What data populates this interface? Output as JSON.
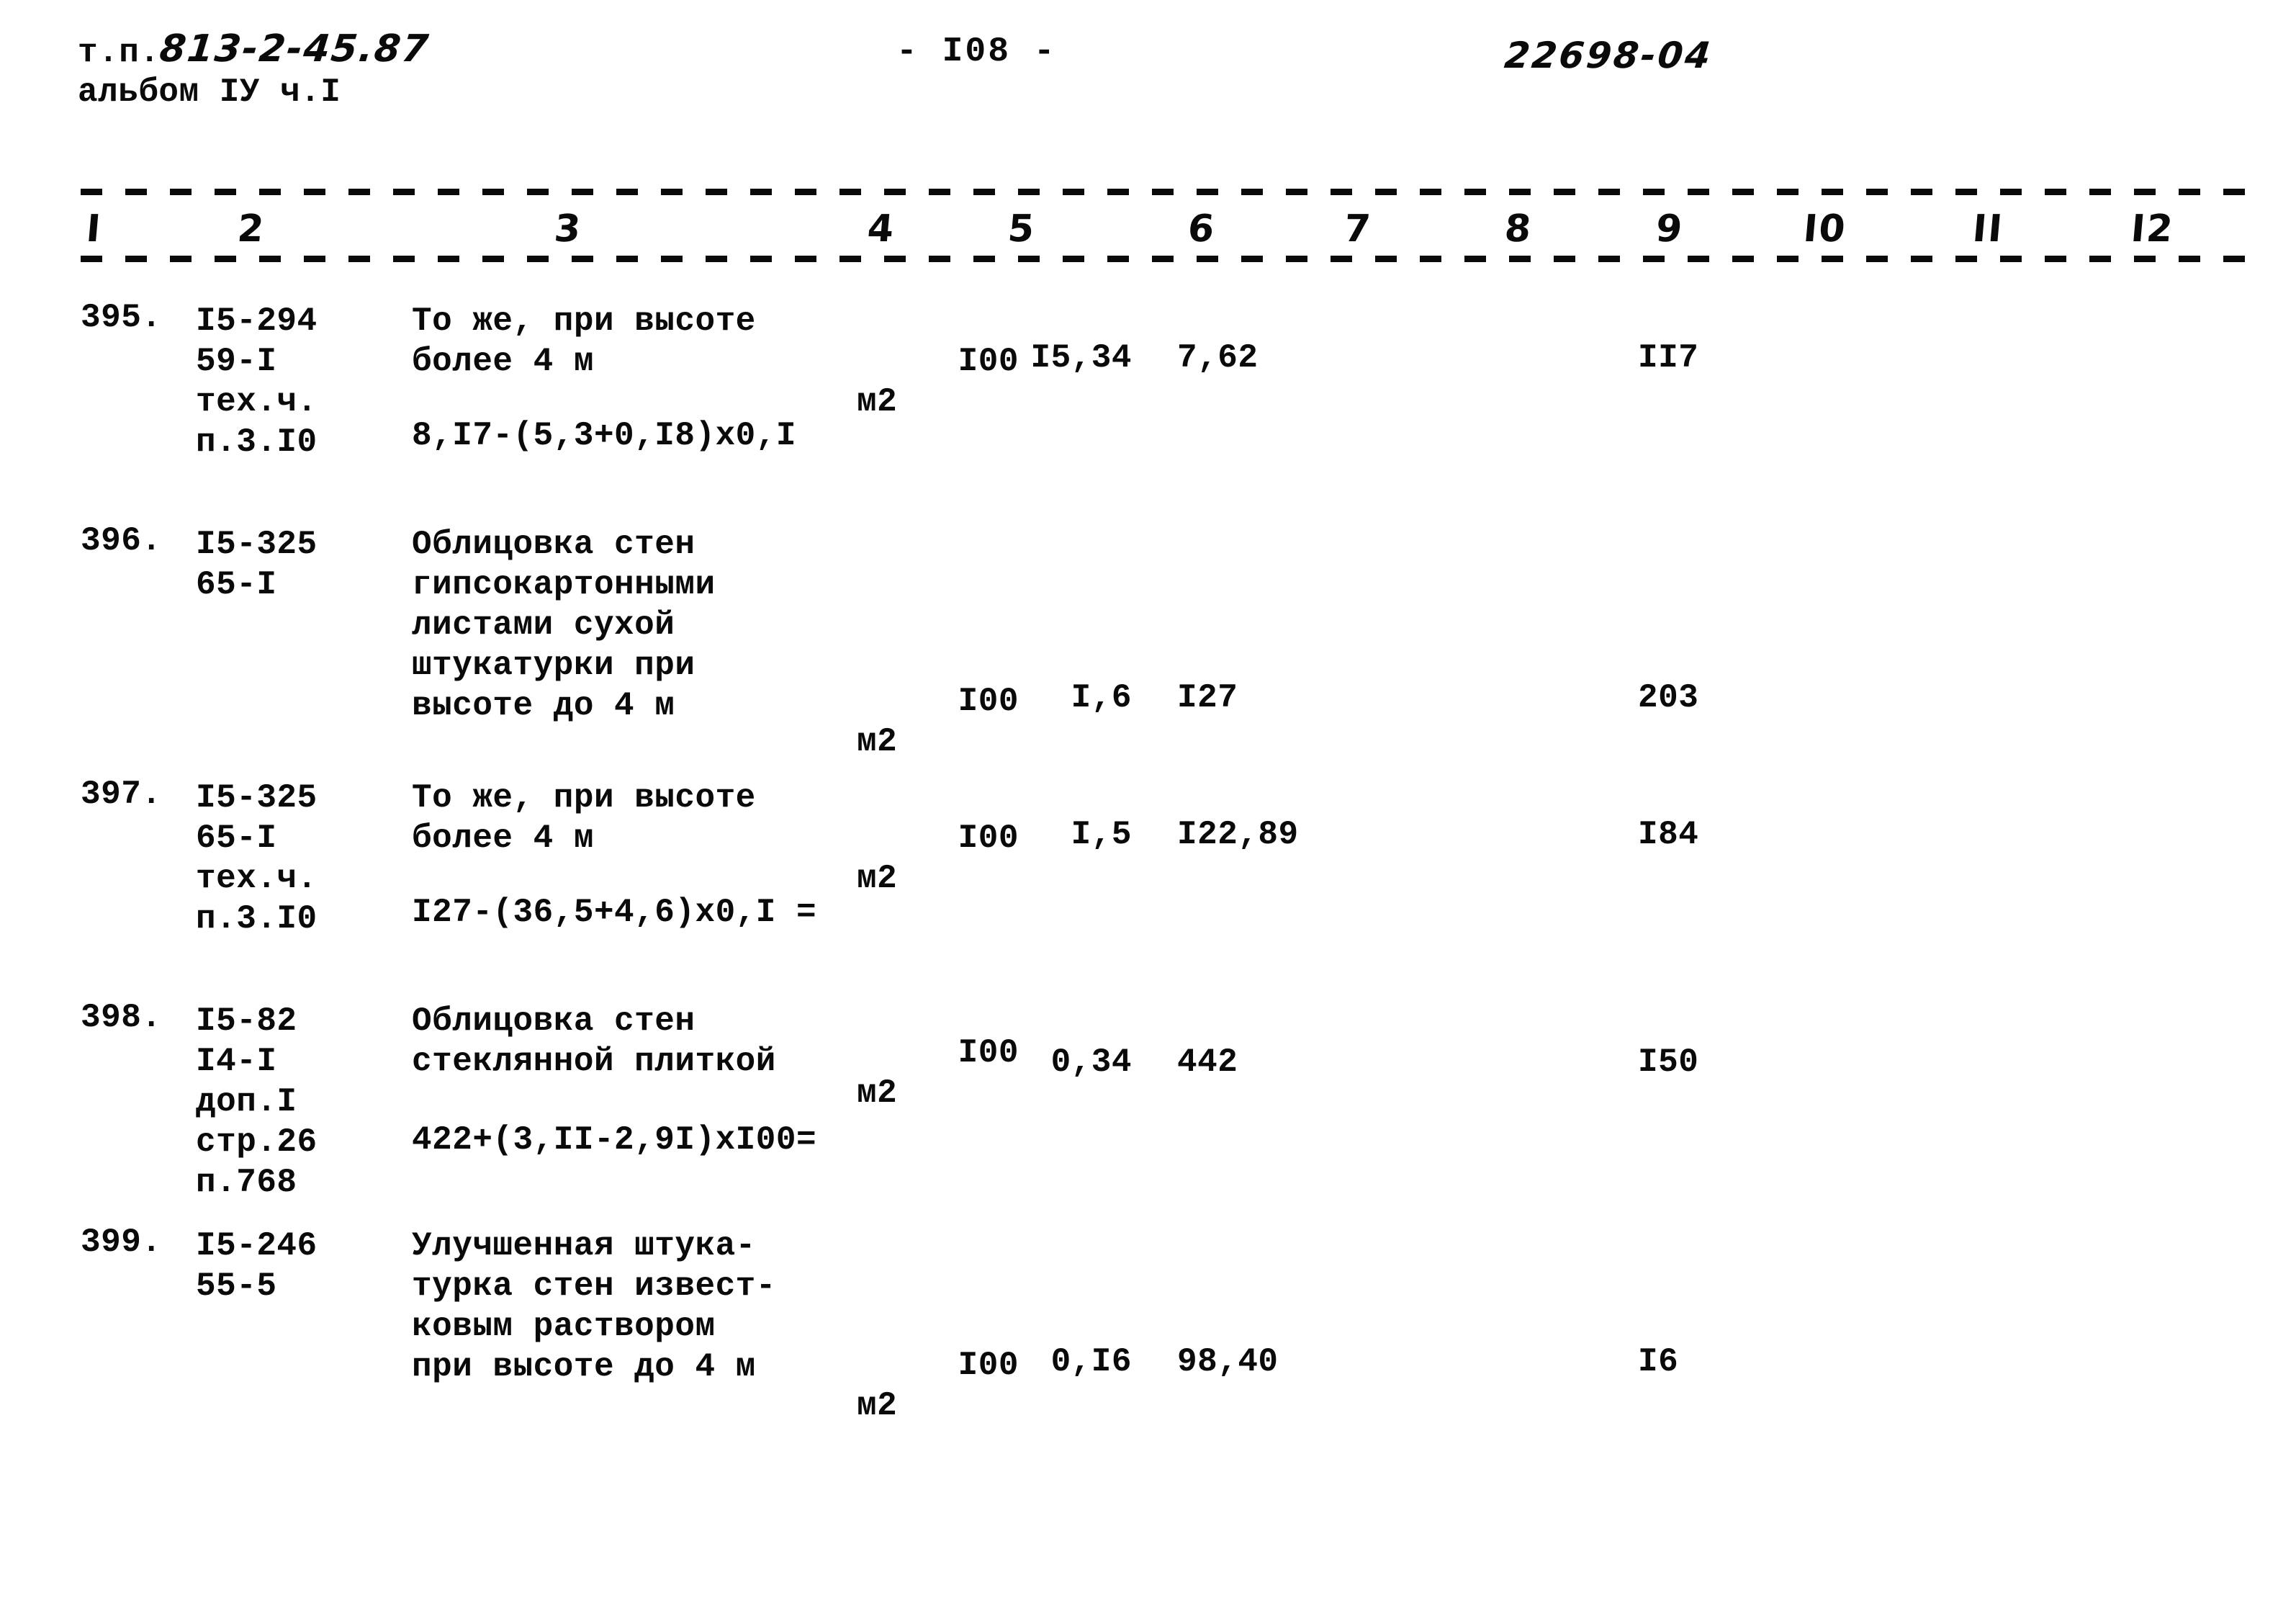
{
  "header": {
    "type_prefix": "т.п.",
    "type_code": "813-2-45.87",
    "album_line": "альбом IУ ч.I",
    "page_number": "- I08 -",
    "doc_number": "22698-04"
  },
  "table": {
    "column_headers": [
      "I",
      "2",
      "3",
      "4",
      "5",
      "6",
      "7",
      "8",
      "9",
      "I0",
      "II",
      "I2"
    ],
    "rows": [
      {
        "num": "395.",
        "code_lines": [
          "I5-294",
          "59-I",
          "тех.ч.",
          "п.3.I0"
        ],
        "desc_lines": [
          "То же, при высоте",
          "более 4 м"
        ],
        "formula": "8,I7-(5,3+0,I8)х0,I",
        "unit_top": "I00",
        "unit_bottom": "м2",
        "col5": "I5,34",
        "col6": "7,62",
        "col7": "",
        "col8": "",
        "col9": "II7",
        "col10": "",
        "col11": "",
        "col12": ""
      },
      {
        "num": "396.",
        "code_lines": [
          "I5-325",
          "65-I"
        ],
        "desc_lines": [
          "Облицовка стен",
          "гипсокартонными",
          "листами сухой",
          "штукатурки при",
          "высоте до 4 м"
        ],
        "formula": "",
        "unit_top": "I00",
        "unit_bottom": "м2",
        "col5": "I,6",
        "col6": "I27",
        "col7": "",
        "col8": "",
        "col9": "203",
        "col10": "",
        "col11": "",
        "col12": ""
      },
      {
        "num": "397.",
        "code_lines": [
          "I5-325",
          "65-I",
          "тех.ч.",
          "п.3.I0"
        ],
        "desc_lines": [
          "То же, при высоте",
          "более 4 м"
        ],
        "formula": "I27-(36,5+4,6)х0,I =",
        "unit_top": "I00",
        "unit_bottom": "м2",
        "col5": "I,5",
        "col6": "I22,89",
        "col7": "",
        "col8": "",
        "col9": "I84",
        "col10": "",
        "col11": "",
        "col12": ""
      },
      {
        "num": "398.",
        "code_lines": [
          "I5-82",
          "I4-I",
          "доп.I",
          "стр.26",
          "п.768"
        ],
        "desc_lines": [
          "Облицовка стен",
          "стеклянной плиткой"
        ],
        "formula": "422+(3,II-2,9I)хI00=",
        "unit_top": "I00",
        "unit_bottom": "м2",
        "col5": "0,34",
        "col6": "442",
        "col7": "",
        "col8": "",
        "col9": "I50",
        "col10": "",
        "col11": "",
        "col12": ""
      },
      {
        "num": "399.",
        "code_lines": [
          "I5-246",
          "55-5"
        ],
        "desc_lines": [
          "Улучшенная штука-",
          "турка стен извест-",
          "ковым раствором",
          "при высоте до 4 м"
        ],
        "formula": "",
        "unit_top": "I00",
        "unit_bottom": "м2",
        "col5": "0,I6",
        "col6": "98,40",
        "col7": "",
        "col8": "",
        "col9": "I6",
        "col10": "",
        "col11": "",
        "col12": ""
      }
    ]
  }
}
